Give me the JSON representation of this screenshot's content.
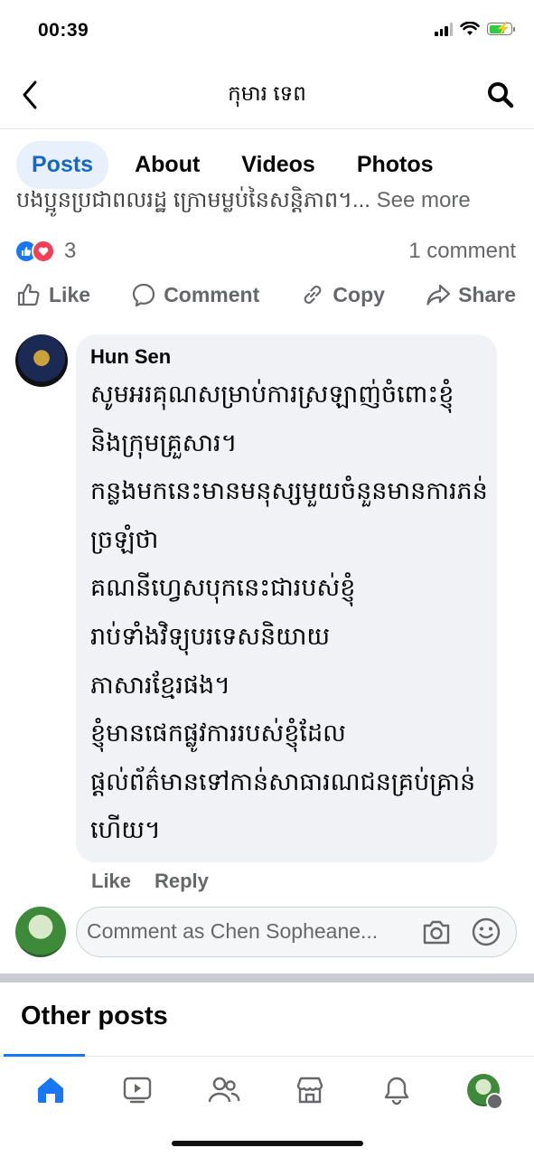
{
  "status": {
    "time": "00:39"
  },
  "header": {
    "title": "កុមារ ទេព"
  },
  "tabs": [
    {
      "label": "Posts",
      "active": true
    },
    {
      "label": "About",
      "active": false
    },
    {
      "label": "Videos",
      "active": false
    },
    {
      "label": "Photos",
      "active": false
    }
  ],
  "post": {
    "text_excerpt": "បងប្អូនប្រជាពលរដ្ឋ ក្រោមម្លប់នៃសន្តិភាព។...",
    "see_more": "See more",
    "reaction_count": "3",
    "comment_count": "1 comment",
    "actions": {
      "like": "Like",
      "comment": "Comment",
      "copy": "Copy",
      "share": "Share"
    }
  },
  "comment": {
    "author": "Hun Sen",
    "lines": [
      "សូមអរគុណសម្រាប់ការស្រឡាញ់ចំពោះខ្ញុំ",
      "និងក្រុមគ្រួសារ។",
      "កន្លងមកនេះមានមនុស្សមួយចំនួនមានការភន់",
      "ច្រឡំថា",
      "គណនីហ្វេសបុកនេះជារបស់ខ្ញុំ",
      "រាប់ទាំងវិទ្យុបរទេសនិយាយ",
      "ភាសារខ្មែរផង។",
      "ខ្ញុំមានផេកផ្លូវការរបស់ខ្ញុំដែល",
      "ផ្តល់ព័ត៌មានទៅកាន់សាធារណជនគ្រប់គ្រាន់",
      "ហើយ។"
    ],
    "like": "Like",
    "reply": "Reply"
  },
  "composer": {
    "placeholder": "Comment as Chen Sopheane..."
  },
  "other_posts": {
    "title": "Other posts"
  },
  "colors": {
    "accent": "#1877f2",
    "tab_active_bg": "#e7f0fb",
    "bubble_bg": "#f0f2f5"
  }
}
